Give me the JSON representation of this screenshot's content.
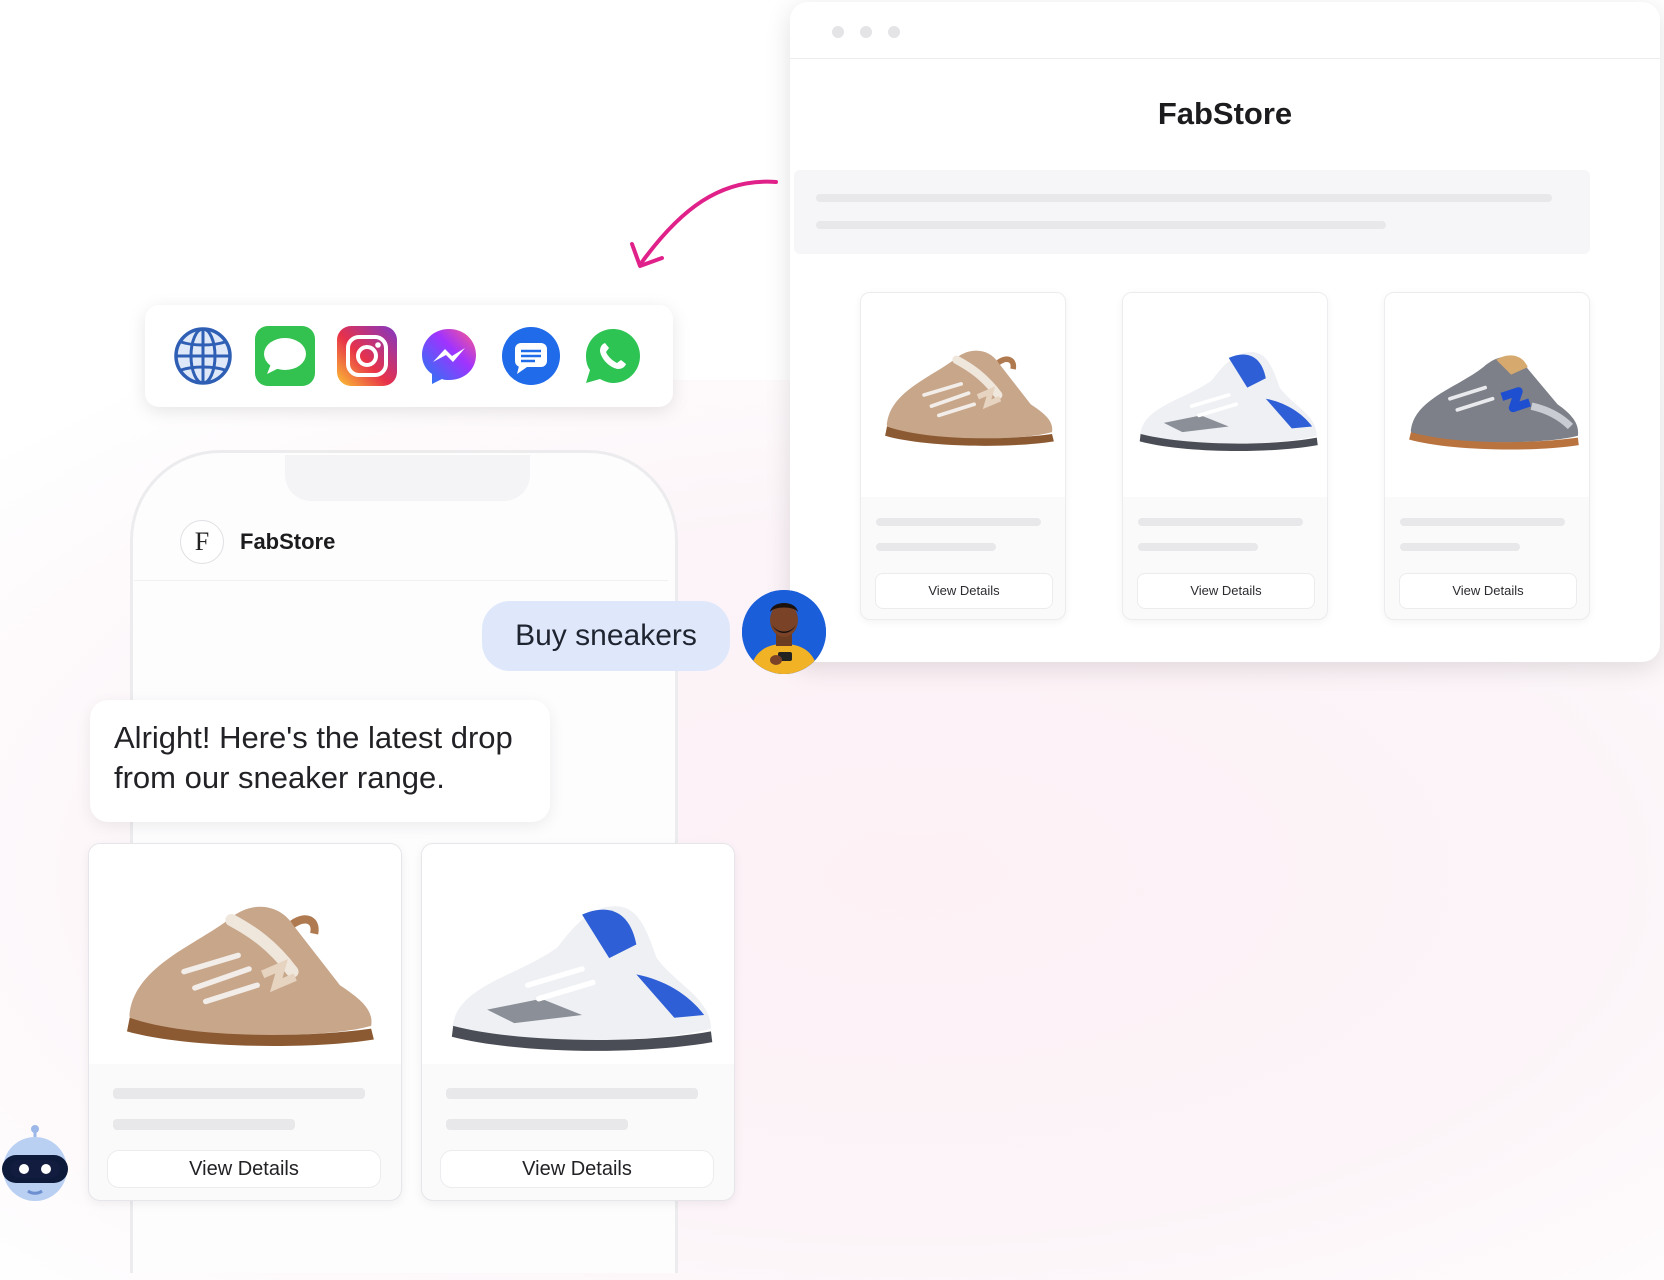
{
  "browser": {
    "title": "FabStore",
    "products": [
      {
        "button": "View Details",
        "image": "sneaker-tan-icon"
      },
      {
        "button": "View Details",
        "image": "sneaker-white-blue-icon"
      },
      {
        "button": "View Details",
        "image": "sneaker-grey-blue-icon"
      }
    ]
  },
  "channels": [
    "web-globe-icon",
    "imessage-icon",
    "instagram-icon",
    "messenger-icon",
    "sms-icon",
    "whatsapp-icon"
  ],
  "chat": {
    "brand_initial": "F",
    "brand_name": "FabStore",
    "user_message": "Buy sneakers",
    "bot_message": "Alright! Here's the latest drop from our sneaker range.",
    "products": [
      {
        "button": "View Details",
        "image": "sneaker-tan-icon"
      },
      {
        "button": "View Details",
        "image": "sneaker-white-blue-icon"
      }
    ]
  },
  "colors": {
    "accent_arrow": "#e0218a",
    "user_bubble": "#dfe8fb"
  }
}
